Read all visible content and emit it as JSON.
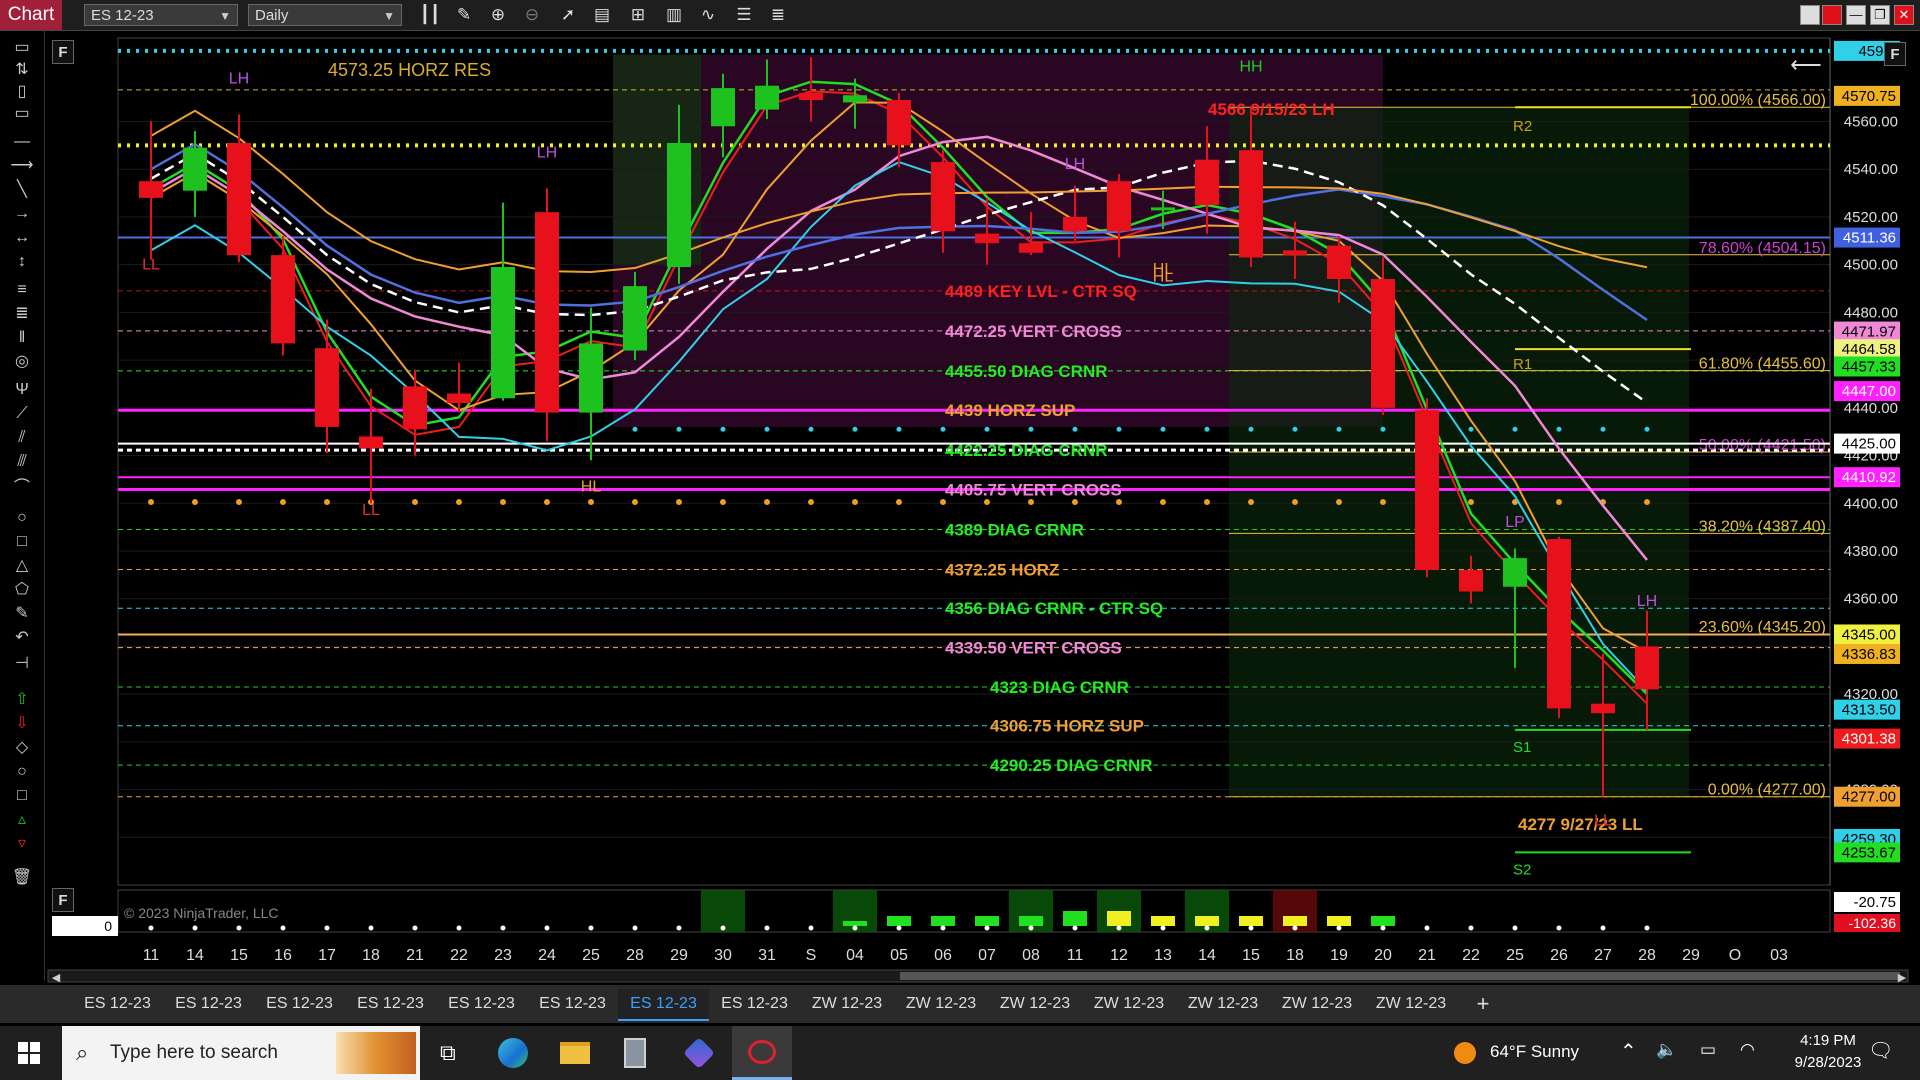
{
  "titlebar": {
    "app_tab": "Chart",
    "instrument": "ES 12-23",
    "period": "Daily"
  },
  "toolbar_icons": [
    "bar-type-icon",
    "pencil-icon",
    "zoom-in-icon",
    "zoom-out-icon",
    "pointer-icon",
    "data-box-icon",
    "chart-trader-icon",
    "strategies-icon",
    "indicators-icon",
    "properties-icon",
    "list-icon"
  ],
  "panel_labels": {
    "main_f": "F",
    "right_f": "F",
    "sub_f": "F",
    "sub_zero": "0"
  },
  "copyright": "© 2023 NinjaTrader, LLC",
  "colors": {
    "background": "#000000",
    "up_candle": "#1ec21e",
    "down_candle": "#e8101a",
    "green_line": "#22dd22",
    "red_line": "#ee1c1c",
    "orange_line": "#f0a030",
    "pink_line": "#f088d8",
    "cyan_line": "#30d0e8",
    "blue_line": "#5070e0",
    "magenta": "#ff22ff",
    "gold": "#e8b830"
  },
  "chart_data": {
    "type": "candlestick",
    "instrument": "ES 12-23",
    "period": "Daily",
    "ylim": [
      4240,
      4595
    ],
    "x_labels": [
      "11",
      "14",
      "15",
      "16",
      "17",
      "18",
      "21",
      "22",
      "23",
      "24",
      "25",
      "28",
      "29",
      "30",
      "31",
      "S",
      "04",
      "05",
      "06",
      "07",
      "08",
      "11",
      "12",
      "13",
      "14",
      "15",
      "18",
      "19",
      "20",
      "21",
      "22",
      "25",
      "26",
      "27",
      "28",
      "29",
      "O",
      "03"
    ],
    "candles": [
      {
        "o": 4535,
        "h": 4560,
        "l": 4502,
        "c": 4528
      },
      {
        "o": 4531,
        "h": 4556,
        "l": 4520,
        "c": 4549
      },
      {
        "o": 4551,
        "h": 4563,
        "l": 4501,
        "c": 4504
      },
      {
        "o": 4504,
        "h": 4512,
        "l": 4462,
        "c": 4467
      },
      {
        "o": 4465,
        "h": 4477,
        "l": 4421,
        "c": 4432
      },
      {
        "o": 4428,
        "h": 4448,
        "l": 4400,
        "c": 4423
      },
      {
        "o": 4449,
        "h": 4456,
        "l": 4420,
        "c": 4431
      },
      {
        "o": 4446,
        "h": 4459,
        "l": 4438,
        "c": 4442
      },
      {
        "o": 4444,
        "h": 4526,
        "l": 4443,
        "c": 4499
      },
      {
        "o": 4522,
        "h": 4532,
        "l": 4426,
        "c": 4438
      },
      {
        "o": 4438,
        "h": 4482,
        "l": 4418,
        "c": 4467
      },
      {
        "o": 4464,
        "h": 4497,
        "l": 4460,
        "c": 4491
      },
      {
        "o": 4499,
        "h": 4567,
        "l": 4492,
        "c": 4551
      },
      {
        "o": 4558,
        "h": 4580,
        "l": 4545,
        "c": 4574
      },
      {
        "o": 4565,
        "h": 4586,
        "l": 4561,
        "c": 4575
      },
      {
        "o": 4572,
        "h": 4587,
        "l": 4560,
        "c": 4569
      },
      {
        "o": 4568,
        "h": 4578,
        "l": 4557,
        "c": 4571
      },
      {
        "o": 4569,
        "h": 4572,
        "l": 4541,
        "c": 4550
      },
      {
        "o": 4543,
        "h": 4548,
        "l": 4505,
        "c": 4514
      },
      {
        "o": 4513,
        "h": 4528,
        "l": 4500,
        "c": 4509
      },
      {
        "o": 4509,
        "h": 4522,
        "l": 4504,
        "c": 4505
      },
      {
        "o": 4520,
        "h": 4533,
        "l": 4510,
        "c": 4514
      },
      {
        "o": 4535,
        "h": 4538,
        "l": 4503,
        "c": 4514
      },
      {
        "o": 4523,
        "h": 4531,
        "l": 4515,
        "c": 4524
      },
      {
        "o": 4544,
        "h": 4558,
        "l": 4513,
        "c": 4525
      },
      {
        "o": 4548,
        "h": 4566,
        "l": 4499,
        "c": 4503
      },
      {
        "o": 4506,
        "h": 4518,
        "l": 4494,
        "c": 4504
      },
      {
        "o": 4508,
        "h": 4512,
        "l": 4484,
        "c": 4494
      },
      {
        "o": 4494,
        "h": 4503,
        "l": 4437,
        "c": 4440
      },
      {
        "o": 4439,
        "h": 4444,
        "l": 4369,
        "c": 4372
      },
      {
        "o": 4372,
        "h": 4378,
        "l": 4358,
        "c": 4363
      },
      {
        "o": 4365,
        "h": 4381,
        "l": 4331,
        "c": 4377
      },
      {
        "o": 4385,
        "h": 4386,
        "l": 4310,
        "c": 4314
      },
      {
        "o": 4316,
        "h": 4337,
        "l": 4277,
        "c": 4312
      },
      {
        "o": 4340,
        "h": 4355,
        "l": 4305,
        "c": 4322
      }
    ],
    "levels": [
      {
        "price": 4589.6,
        "text": "4590",
        "kind": "dotted"
      },
      {
        "price": 4573.25,
        "text": "4573.25 HORZ RES",
        "kind": "dash"
      },
      {
        "price": 4566,
        "text": "4566 9/15/23 LH",
        "kind": "label"
      },
      {
        "price": 4566,
        "text": "100.00% (4566.00)",
        "kind": "fib"
      },
      {
        "price": 4550,
        "text": "",
        "kind": "yellow-dotted"
      },
      {
        "price": 4511.36,
        "text": "4511.36",
        "kind": "solid-blue"
      },
      {
        "price": 4504.15,
        "text": "78.60% (4504.15)",
        "kind": "fib"
      },
      {
        "price": 4489,
        "text": "4489 KEY LVL - CTR SQ",
        "kind": "label"
      },
      {
        "price": 4472.25,
        "text": "4472.25 VERT CROSS",
        "kind": "label"
      },
      {
        "price": 4455.5,
        "text": "4455.50 DIAG CRNR",
        "kind": "label"
      },
      {
        "price": 4455.6,
        "text": "61.80% (4455.60)",
        "kind": "fib"
      },
      {
        "price": 4439,
        "text": "4439 HORZ SUP",
        "kind": "label"
      },
      {
        "price": 4422.25,
        "text": "4422.25 DIAG CRNR",
        "kind": "label"
      },
      {
        "price": 4421.5,
        "text": "50.00% (4421.50)",
        "kind": "fib"
      },
      {
        "price": 4405.75,
        "text": "4405.75 VERT CROSS",
        "kind": "label"
      },
      {
        "price": 4389,
        "text": "4389 DIAG CRNR",
        "kind": "label"
      },
      {
        "price": 4387.4,
        "text": "38.20% (4387.40)",
        "kind": "fib"
      },
      {
        "price": 4372.25,
        "text": "4372.25 HORZ",
        "kind": "label"
      },
      {
        "price": 4356,
        "text": "4356 DIAG CRNR - CTR SQ",
        "kind": "label"
      },
      {
        "price": 4345.2,
        "text": "23.60% (4345.20)",
        "kind": "fib"
      },
      {
        "price": 4339.5,
        "text": "4339.50 VERT CROSS",
        "kind": "label"
      },
      {
        "price": 4323,
        "text": "4323 DIAG CRNR",
        "kind": "label"
      },
      {
        "price": 4306.75,
        "text": "4306.75 HORZ SUP",
        "kind": "label"
      },
      {
        "price": 4290.25,
        "text": "4290.25 DIAG CRNR",
        "kind": "label"
      },
      {
        "price": 4277,
        "text": "0.00% (4277.00)",
        "kind": "fib"
      },
      {
        "price": 4277,
        "text": "4277 9/27/23 LL",
        "kind": "label"
      }
    ],
    "pivot_labels": [
      "R2",
      "R1",
      "S1",
      "S2"
    ],
    "swing_labels": [
      "LL",
      "LH",
      "LH",
      "LL",
      "HL",
      "HL",
      "HH",
      "LH",
      "HL",
      "LH",
      "LP",
      "LL"
    ],
    "y_axis_ticks": [
      "4560.00",
      "4540.00",
      "4520.00",
      "4500.00",
      "4480.00",
      "4460.00",
      "4440.00",
      "4420.00",
      "4400.00",
      "4380.00",
      "4360.00",
      "4340.00",
      "4320.00",
      "4300.00",
      "4280.00",
      "4260.00"
    ],
    "price_tags": [
      {
        "text": "4590.",
        "color": "#30d0e8"
      },
      {
        "text": "4570.75",
        "color": "#f0b020"
      },
      {
        "text": "4511.36",
        "color": "#4060e0"
      },
      {
        "text": "4471.97",
        "color": "#f088d8"
      },
      {
        "text": "4464.58",
        "color": "#f0f080"
      },
      {
        "text": "4457.33",
        "color": "#22dd22"
      },
      {
        "text": "4447.00",
        "color": "#ff22ff"
      },
      {
        "text": "4425.00",
        "color": "#ffffff"
      },
      {
        "text": "4410.92",
        "color": "#ff22ff"
      },
      {
        "text": "4345.00",
        "color": "#f0f040"
      },
      {
        "text": "4336.83",
        "color": "#f0b020"
      },
      {
        "text": "4313.50",
        "color": "#30d0e8"
      },
      {
        "text": "4301.38",
        "color": "#ee1c1c"
      },
      {
        "text": "4277.00",
        "color": "#f0a030"
      },
      {
        "text": "4259.30",
        "color": "#30d0e8"
      },
      {
        "text": "4253.67",
        "color": "#22dd22"
      }
    ],
    "sub_panel": {
      "ticks": [
        "-20.75",
        "-102.36"
      ],
      "histogram": [
        0,
        0,
        0,
        0,
        0,
        0,
        0,
        0,
        0,
        0,
        0,
        0,
        0,
        0,
        0,
        0,
        1,
        2,
        2,
        2,
        2,
        3,
        3,
        2,
        2,
        2,
        2,
        2,
        2,
        0,
        0,
        0,
        0,
        0,
        0
      ],
      "histogram_colors": [
        "green",
        "green",
        "green",
        "green",
        "green",
        "green",
        "yellow",
        "yellow",
        "yellow",
        "yellow",
        "yellow"
      ]
    }
  },
  "doc_tabs": [
    "ES 12-23",
    "ES 12-23",
    "ES 12-23",
    "ES 12-23",
    "ES 12-23",
    "ES 12-23",
    "ES 12-23",
    "ES 12-23",
    "ZW 12-23",
    "ZW 12-23",
    "ZW 12-23",
    "ZW 12-23",
    "ZW 12-23",
    "ZW 12-23",
    "ZW 12-23"
  ],
  "active_tab_index": 6,
  "add_tab": "+",
  "taskbar": {
    "search_placeholder": "Type here to search",
    "weather": "64°F  Sunny",
    "time": "4:19 PM",
    "date": "9/28/2023"
  }
}
